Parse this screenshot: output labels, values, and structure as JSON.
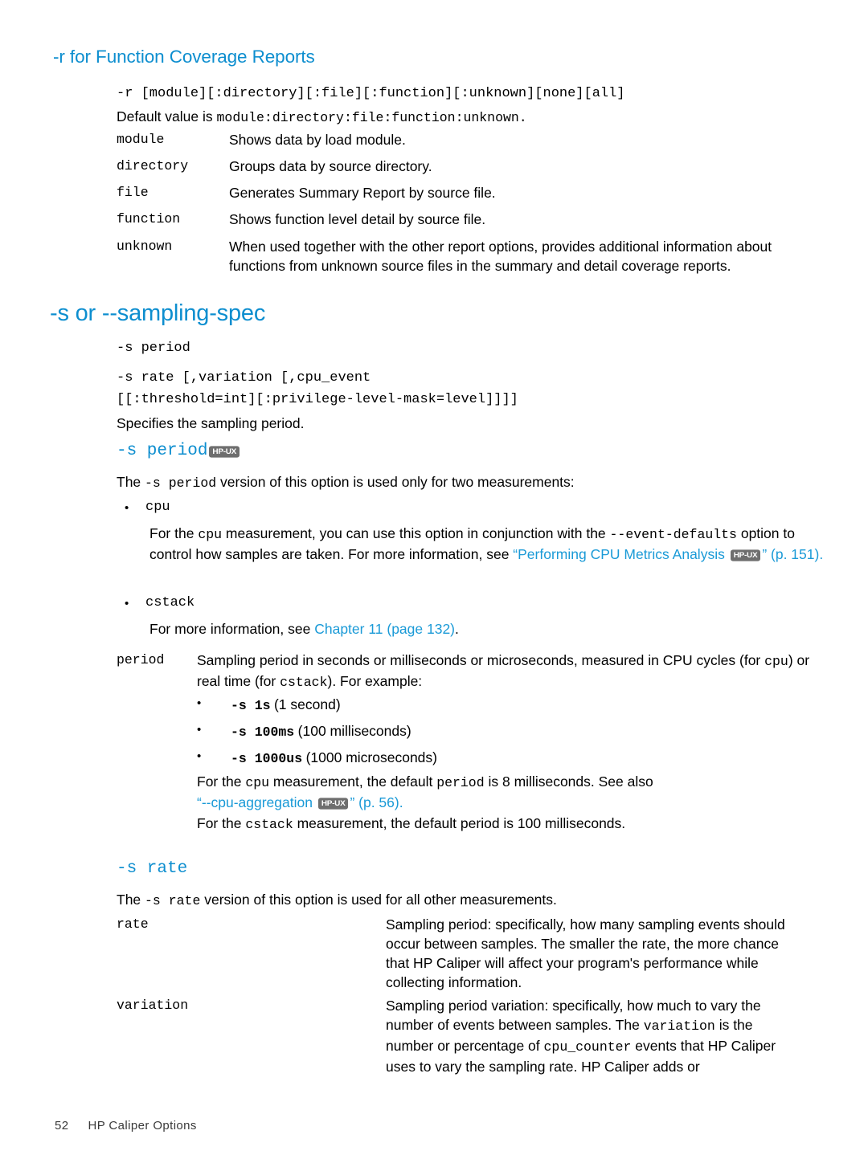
{
  "colors": {
    "heading_blue": "#0d8ecf",
    "link_blue": "#1a9ad7",
    "badge_gray": "#6e6e6e",
    "text": "#000000",
    "page_bg": "#ffffff"
  },
  "badge": {
    "label": "HP-UX"
  },
  "section_r": {
    "heading": "-r for Function Coverage Reports",
    "syntax": "-r [module][:directory][:file][:function][:unknown][none][all]",
    "default_prefix": "Default value is ",
    "default_value": "module:directory:file:function:unknown.",
    "terms": [
      {
        "term": "module",
        "desc": "Shows data by load module."
      },
      {
        "term": "directory",
        "desc": "Groups data by source directory."
      },
      {
        "term": "file",
        "desc": "Generates Summary Report by source file."
      },
      {
        "term": "function",
        "desc": "Shows function level detail by source file."
      },
      {
        "term": "unknown",
        "desc": "When used together with the other report options, provides additional information about functions from unknown source files in the summary and detail coverage reports."
      }
    ]
  },
  "section_s": {
    "heading": "-s or --sampling-spec",
    "syntax_line_1": "-s period",
    "syntax_line_2": "-s rate [,variation [,cpu_event",
    "syntax_line_3": "[[:threshold=int][:privilege-level-mask=level]]]]",
    "intro": "Specifies the sampling period."
  },
  "s_period": {
    "heading_text": "-s period",
    "intro_pre": "The ",
    "intro_code": "-s period",
    "intro_post": " version of this option is used only for two measurements:",
    "bullets": [
      {
        "label": "cpu",
        "body_1_pre": "For the ",
        "body_1_code": "cpu",
        "body_1_mid": " measurement, you can use this option in conjunction with the ",
        "body_1_code2": "--event-defaults",
        "body_2": "option to control how samples are taken. For more information, see ",
        "link_open_quote": "“Performing CPU Metrics Analysis ",
        "link_close_quote": "”",
        "page_ref": " (p. 151)."
      },
      {
        "label": "cstack",
        "body_pre": "For more information, see ",
        "link": "Chapter 11 (page 132)",
        "body_post": "."
      }
    ],
    "period_term": "period",
    "period_desc_1_pre": "Sampling period in seconds or milliseconds or microseconds, measured in CPU cycles (for ",
    "period_desc_1_code1": "cpu",
    "period_desc_1_mid": ") or real time (for ",
    "period_desc_1_code2": "cstack",
    "period_desc_1_post": "). For example:",
    "examples": [
      {
        "code": "-s 1s",
        "text": "(1 second)"
      },
      {
        "code": "-s 100ms",
        "text": "(100 milliseconds)"
      },
      {
        "code": "-s 1000us",
        "text": "(1000 microseconds)"
      }
    ],
    "default_cpu_pre": "For the ",
    "default_cpu_code1": "cpu",
    "default_cpu_mid": " measurement, the default ",
    "default_cpu_code2": "period",
    "default_cpu_post": " is 8 milliseconds. See also",
    "see_also_link": "“--cpu-aggregation ",
    "see_also_close": "”",
    "see_also_page": " (p. 56).",
    "default_cstack_pre": "For the ",
    "default_cstack_code": "cstack",
    "default_cstack_post": " measurement, the default period is 100 milliseconds."
  },
  "s_rate": {
    "heading_text": "-s rate",
    "intro_pre": "The ",
    "intro_code": "-s rate",
    "intro_post": " version of this option is used for all other measurements.",
    "rows": [
      {
        "term": "rate",
        "desc_part_1": "Sampling period: specifically, how many sampling events should occur between samples. The smaller the rate, the more chance that HP Caliper will affect your program's performance while collecting information."
      },
      {
        "term": "variation",
        "desc_part_1": "Sampling period variation: specifically, how much to vary the number of events between samples. The ",
        "desc_code_1": "variation",
        "desc_part_2": " is the number or percentage of ",
        "desc_code_2": "cpu_counter",
        "desc_part_3": " events that HP Caliper uses to vary the sampling rate. HP Caliper adds or"
      }
    ]
  },
  "footer": {
    "page_number": "52",
    "title": "HP Caliper Options"
  }
}
